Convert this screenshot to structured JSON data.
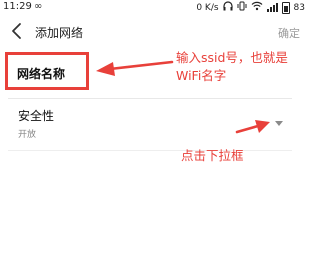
{
  "status_bar": {
    "time": "11:29",
    "network_speed": "0 K/s",
    "battery_level": "83"
  },
  "header": {
    "title": "添加网络",
    "confirm_label": "确定"
  },
  "form": {
    "network_name_label": "网络名称",
    "security_label": "安全性",
    "security_value": "开放"
  },
  "annotations": {
    "ssid_note": "输入ssid号，也就是WiFi名字",
    "dropdown_note": "点击下拉框"
  },
  "colors": {
    "annotation_red": "#e8403a",
    "text_primary": "#111111",
    "text_secondary": "#888888",
    "confirm_disabled": "#9a9a9a"
  }
}
